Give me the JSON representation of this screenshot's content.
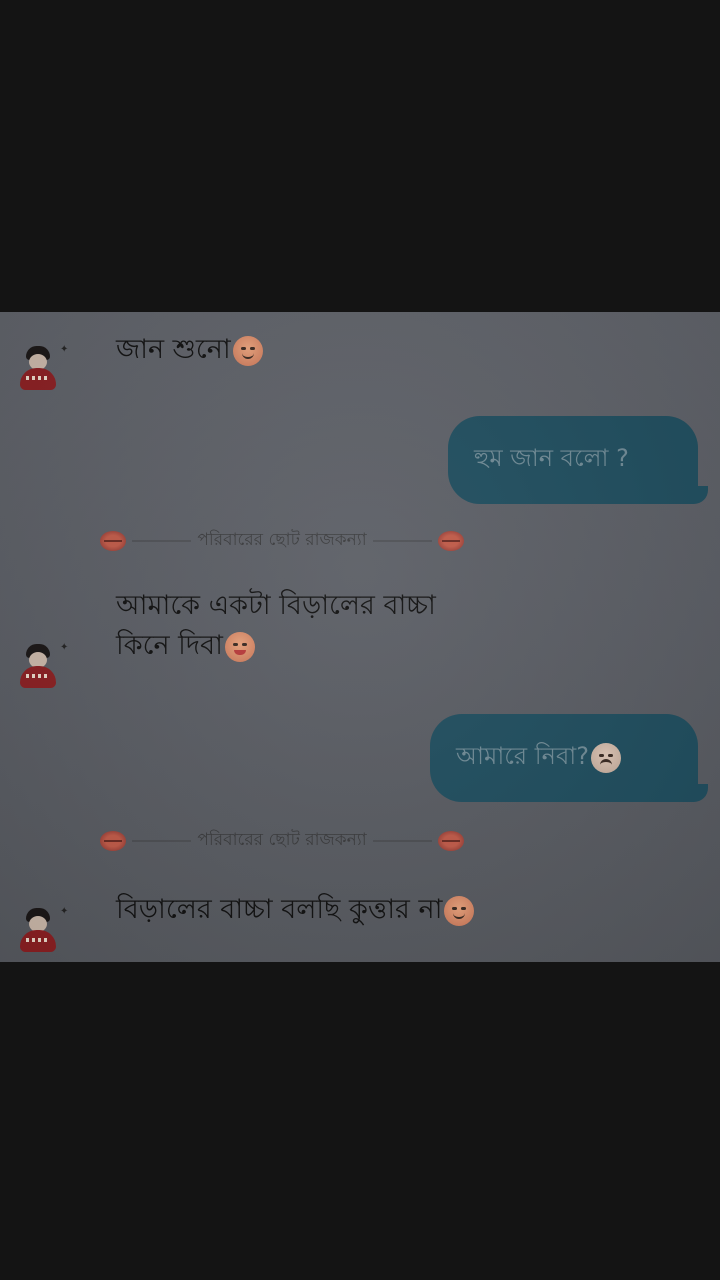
{
  "messages": [
    {
      "type": "incoming",
      "text": "জান শুনো",
      "emoji": "smiling-face-icon"
    },
    {
      "type": "outgoing",
      "text": "হুম জান বলো ?"
    },
    {
      "type": "divider",
      "label": "পরিবারের ছোট রাজকন্যা",
      "icon": "kiss-mark-icon"
    },
    {
      "type": "incoming",
      "line1": "আমাকে একটা বিড়ালের বাচ্চা",
      "line2": "কিনে দিবা",
      "emoji": "tongue-face-icon"
    },
    {
      "type": "outgoing",
      "text": "আমারে নিবা?",
      "emoji": "weary-face-icon"
    },
    {
      "type": "divider",
      "label": "পরিবারের ছোট রাজকন্যা",
      "icon": "kiss-mark-icon"
    },
    {
      "type": "incoming",
      "text": "বিড়ালের বাচ্চা বলছি কুত্তার না",
      "emoji": "smiling-face-icon"
    }
  ],
  "colors": {
    "chat_background": "#5a5d64",
    "outgoing_bubble": "#1f4d5e",
    "outgoing_text": "#6f8a95",
    "incoming_text": "#101010",
    "letterbox": "#141414"
  }
}
